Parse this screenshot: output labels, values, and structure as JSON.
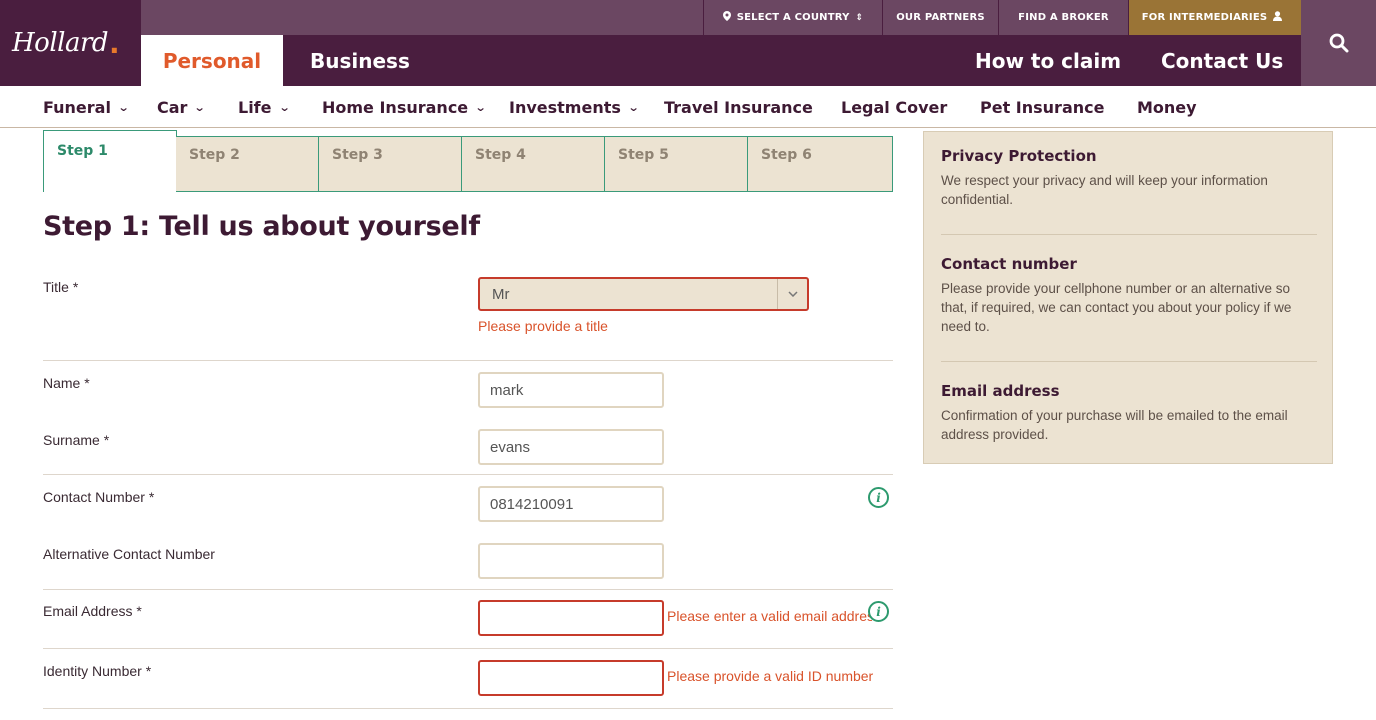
{
  "header": {
    "logo": "Hollard",
    "utility": {
      "country": "SELECT A COUNTRY",
      "partners": "OUR PARTNERS",
      "broker": "FIND A BROKER",
      "intermediaries": "FOR INTERMEDIARIES"
    },
    "tabs": {
      "personal": "Personal",
      "business": "Business"
    },
    "links": {
      "claim": "How to claim",
      "contact": "Contact Us"
    }
  },
  "catnav": {
    "funeral": "Funeral",
    "car": "Car",
    "life": "Life",
    "home": "Home Insurance",
    "investments": "Investments",
    "travel": "Travel Insurance",
    "legal": "Legal Cover",
    "pet": "Pet Insurance",
    "money": "Money"
  },
  "steps": [
    "Step 1",
    "Step 2",
    "Step 3",
    "Step 4",
    "Step 5",
    "Step 6"
  ],
  "form": {
    "title": "Step 1: Tell us about yourself",
    "title_field": {
      "label": "Title *",
      "value": "Mr",
      "error": "Please provide a title"
    },
    "name": {
      "label": "Name *",
      "value": "mark"
    },
    "surname": {
      "label": "Surname *",
      "value": "evans"
    },
    "contact": {
      "label": "Contact Number *",
      "value": "0814210091"
    },
    "alt_contact": {
      "label": "Alternative Contact Number",
      "value": ""
    },
    "email": {
      "label": "Email Address *",
      "value": "",
      "error": "Please enter a valid email addres"
    },
    "id_number": {
      "label": "Identity Number *",
      "value": "",
      "error": "Please provide a valid ID number"
    }
  },
  "sidebar": {
    "privacy": {
      "title": "Privacy Protection",
      "body": "We respect your privacy and will keep your information confidential."
    },
    "contact": {
      "title": "Contact number",
      "body": "Please provide your cellphone number or an alternative so that, if required, we can contact you about your policy if we need to."
    },
    "email": {
      "title": "Email address",
      "body": "Confirmation of your purchase will be emailed to the email address provided."
    }
  },
  "colors": {
    "brand_purple": "#4a1e3f",
    "accent_orange": "#e05a2b",
    "error_red": "#c63b2b",
    "success_green": "#2d9a6e",
    "beige": "#ece3d2",
    "gold": "#9a7436"
  }
}
